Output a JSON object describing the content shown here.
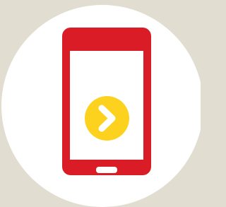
{
  "illustration": {
    "background_color": "#e2ddd1",
    "circle_color": "#ffffff",
    "phone_color": "#d91c26",
    "screen_color": "#ffffff",
    "badge_color": "#fdd21f",
    "icons": [
      "mobile-phone-icon",
      "chevron-right-icon"
    ]
  }
}
